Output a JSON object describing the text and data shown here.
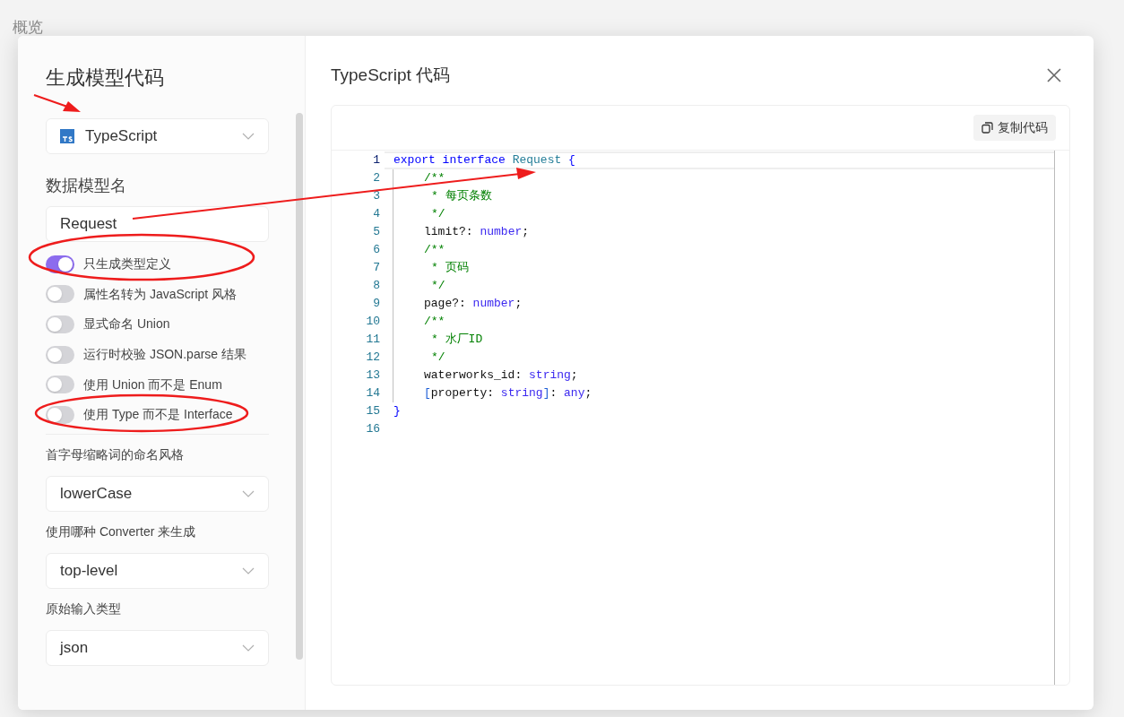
{
  "background": {
    "nav_text": "概览"
  },
  "dialog": {
    "title": "生成模型代码",
    "language_select": {
      "value": "TypeScript"
    },
    "model_name": {
      "label": "数据模型名",
      "value": "Request"
    },
    "options": [
      {
        "label": "只生成类型定义",
        "on": true
      },
      {
        "label": "属性名转为 JavaScript 风格",
        "on": false
      },
      {
        "label": "显式命名 Union",
        "on": false
      },
      {
        "label": "运行时校验 JSON.parse 结果",
        "on": false
      },
      {
        "label": "使用 Union 而不是 Enum",
        "on": false
      },
      {
        "label": "使用 Type 而不是 Interface",
        "on": false
      }
    ],
    "selects": [
      {
        "label": "首字母缩略词的命名风格",
        "value": "lowerCase"
      },
      {
        "label": "使用哪种 Converter 来生成",
        "value": "top-level"
      },
      {
        "label": "原始输入类型",
        "value": "json"
      }
    ]
  },
  "code_panel": {
    "title": "TypeScript 代码",
    "copy_button": "复制代码",
    "lines": [
      {
        "number": "1",
        "kind": "top",
        "tokens": [
          {
            "kind": "keyword",
            "text": "export interface "
          },
          {
            "kind": "type",
            "text": "Request "
          },
          {
            "kind": "keyword",
            "text": "{"
          }
        ]
      },
      {
        "number": "2",
        "kind": "member",
        "tokens": [
          {
            "kind": "comment",
            "text": "/**"
          }
        ]
      },
      {
        "number": "3",
        "kind": "comment_body",
        "tokens": [
          {
            "kind": "comment",
            "text": "* 每页条数"
          }
        ]
      },
      {
        "number": "4",
        "kind": "comment_body",
        "tokens": [
          {
            "kind": "comment",
            "text": "*/"
          }
        ]
      },
      {
        "number": "5",
        "kind": "member",
        "tokens": [
          {
            "kind": "plain",
            "text": "limit?: "
          },
          {
            "kind": "builtin",
            "text": "number"
          },
          {
            "kind": "plain",
            "text": ";"
          }
        ]
      },
      {
        "number": "6",
        "kind": "member",
        "tokens": [
          {
            "kind": "comment",
            "text": "/**"
          }
        ]
      },
      {
        "number": "7",
        "kind": "comment_body",
        "tokens": [
          {
            "kind": "comment",
            "text": "* 页码"
          }
        ]
      },
      {
        "number": "8",
        "kind": "comment_body",
        "tokens": [
          {
            "kind": "comment",
            "text": "*/"
          }
        ]
      },
      {
        "number": "9",
        "kind": "member",
        "tokens": [
          {
            "kind": "plain",
            "text": "page?: "
          },
          {
            "kind": "builtin",
            "text": "number"
          },
          {
            "kind": "plain",
            "text": ";"
          }
        ]
      },
      {
        "number": "10",
        "kind": "member",
        "tokens": [
          {
            "kind": "comment",
            "text": "/**"
          }
        ]
      },
      {
        "number": "11",
        "kind": "comment_body",
        "tokens": [
          {
            "kind": "comment",
            "text": "* 水厂ID"
          }
        ]
      },
      {
        "number": "12",
        "kind": "comment_body",
        "tokens": [
          {
            "kind": "comment",
            "text": "*/"
          }
        ]
      },
      {
        "number": "13",
        "kind": "member",
        "tokens": [
          {
            "kind": "plain",
            "text": "waterworks_id: "
          },
          {
            "kind": "builtin",
            "text": "string"
          },
          {
            "kind": "plain",
            "text": ";"
          }
        ]
      },
      {
        "number": "14",
        "kind": "member",
        "tokens": [
          {
            "kind": "bracket",
            "text": "["
          },
          {
            "kind": "plain",
            "text": "property: "
          },
          {
            "kind": "builtin",
            "text": "string"
          },
          {
            "kind": "bracket",
            "text": "]"
          },
          {
            "kind": "plain",
            "text": ": "
          },
          {
            "kind": "builtin",
            "text": "any"
          },
          {
            "kind": "plain",
            "text": ";"
          }
        ]
      },
      {
        "number": "15",
        "kind": "top",
        "tokens": [
          {
            "kind": "keyword",
            "text": "}"
          }
        ]
      },
      {
        "number": "16",
        "kind": "top"
      }
    ]
  }
}
